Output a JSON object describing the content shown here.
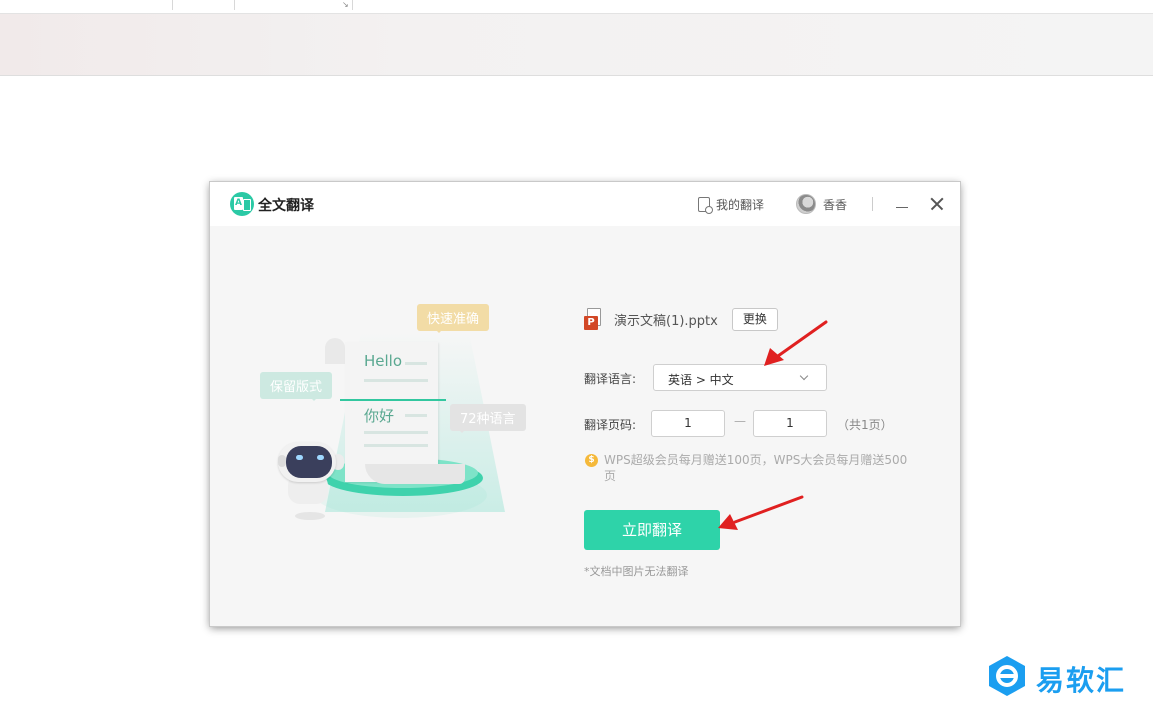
{
  "dialog": {
    "title": "全文翻译",
    "my_translations": "我的翻译",
    "user_name": "香香"
  },
  "illustration": {
    "bubble_fast": "快速准确",
    "bubble_keep": "保留版式",
    "bubble_langs": "72种语言",
    "paper_hello": "Hello",
    "paper_nihao": "你好"
  },
  "form": {
    "file_name": "演示文稿(1).pptx",
    "change_label": "更换",
    "ppt_badge": "P",
    "language_label": "翻译语言:",
    "language_value": "英语 > 中文",
    "pages_label": "翻译页码:",
    "page_from": "1",
    "page_to": "1",
    "page_dash": "—",
    "page_total": "（共1页）",
    "coin_symbol": "$",
    "note": "WPS超级会员每月赠送100页，WPS大会员每月赠送500页",
    "translate_button": "立即翻译",
    "footnote": "*文档中图片无法翻译"
  },
  "watermark": {
    "text": "易软汇"
  },
  "colors": {
    "accent": "#2ed3a9",
    "arrow": "#e02020",
    "watermark": "#1b9ef0"
  }
}
